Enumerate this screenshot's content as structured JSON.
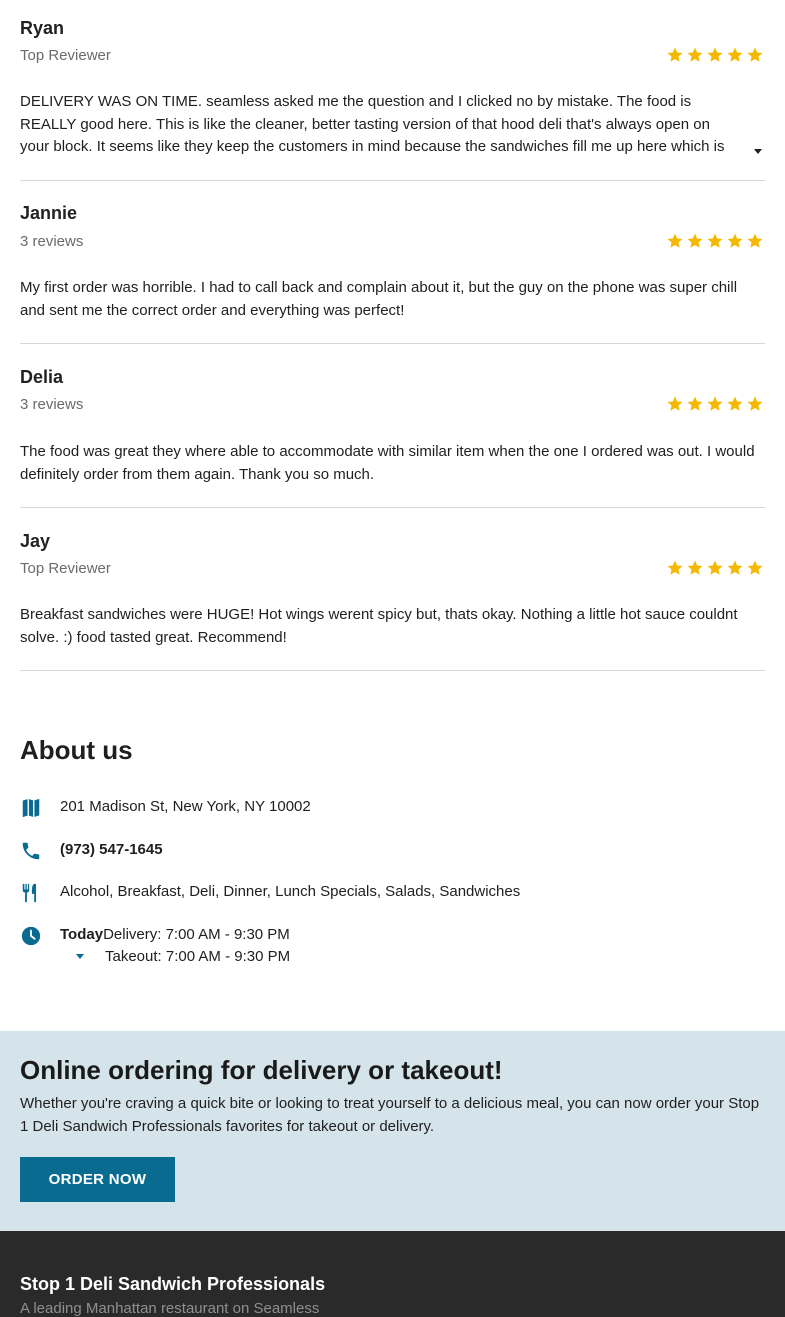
{
  "reviews": [
    {
      "name": "Ryan",
      "meta": "Top Reviewer",
      "rating": 5,
      "text": "DELIVERY WAS ON TIME. seamless asked me the question and I clicked no by mistake. The food is REALLY good here. This is like the cleaner, better tasting version of that hood deli that's always open on your block. It seems like they keep the customers in mind because the sandwiches fill me up here which is why …",
      "expandable": true
    },
    {
      "name": "Jannie",
      "meta": "3 reviews",
      "rating": 5,
      "text": "My first order was horrible. I had to call back and complain about it, but the guy on the phone was super chill and sent me the correct order and everything was perfect!"
    },
    {
      "name": "Delia",
      "meta": "3 reviews",
      "rating": 5,
      "text": "The food was great they where able to accommodate with similar item when the one I ordered was out. I would definitely order from them again. Thank you so much."
    },
    {
      "name": "Jay",
      "meta": "Top Reviewer",
      "rating": 5,
      "text": "Breakfast sandwiches were HUGE! Hot wings werent spicy but, thats okay. Nothing a little hot sauce couldnt solve. :) food tasted great. Recommend!"
    }
  ],
  "about": {
    "title": "About us",
    "address": "201 Madison St, New York, NY 10002",
    "phone": "(973) 547-1645",
    "cuisines": "Alcohol, Breakfast, Deli, Dinner, Lunch Specials, Salads, Sandwiches",
    "hours": {
      "day_label": "Today",
      "delivery": "Delivery: 7:00 AM - 9:30 PM",
      "takeout": "Takeout: 7:00 AM - 9:30 PM"
    },
    "icons": {
      "address": "map-icon",
      "phone": "phone-icon",
      "cuisines": "utensils-icon",
      "hours": "clock-icon"
    }
  },
  "order_banner": {
    "title": "Online ordering for delivery or takeout!",
    "description": "Whether you're craving a quick bite or looking to treat yourself to a delicious meal, you can now order your Stop 1 Deli Sandwich Professionals favorites for takeout or delivery.",
    "button_label": "ORDER NOW"
  },
  "footer": {
    "title": "Stop 1 Deli Sandwich Professionals",
    "subtitle": "A leading Manhattan restaurant on Seamless"
  },
  "colors": {
    "star": "#f5b800",
    "accent": "#0a6b91",
    "banner_bg": "#d4e4ea",
    "footer_bg": "#2a2a2a",
    "divider": "#d8d8d8"
  }
}
